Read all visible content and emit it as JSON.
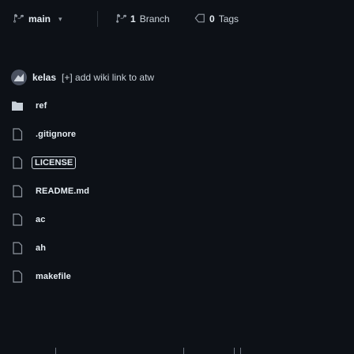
{
  "header": {
    "branch": "main",
    "branches_count": "1",
    "branches_label": "Branch",
    "tags_count": "0",
    "tags_label": "Tags"
  },
  "commit": {
    "author": "kelas",
    "message": "[+] add wiki link to atw"
  },
  "files": [
    {
      "name": "ref",
      "type": "folder-icon"
    },
    {
      "name": ".gitignore",
      "type": "file-icon"
    },
    {
      "name": "LICENSE",
      "type": "file-icon"
    },
    {
      "name": "README.md",
      "type": "file-icon"
    },
    {
      "name": "ac",
      "type": "file-icon"
    },
    {
      "name": "ah",
      "type": "file-icon"
    },
    {
      "name": "makefile",
      "type": "file-icon"
    }
  ],
  "colors": {
    "background": "#0d1117",
    "text": "#e6edf3",
    "muted": "#9198a1",
    "icon": "#9198a1",
    "folder": "#c9d1d9"
  }
}
